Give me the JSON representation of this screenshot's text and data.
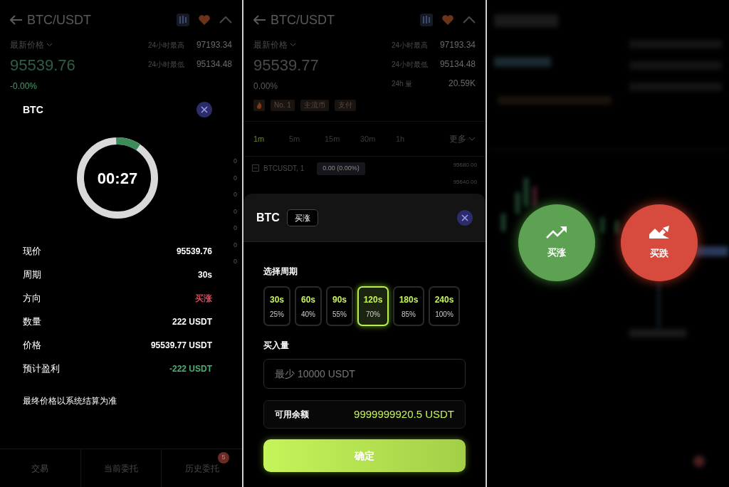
{
  "timer_screen": {
    "header": {
      "title": "BTC/USDT",
      "price_label": "最新价格",
      "price": "95539.76",
      "change": "-0.00%",
      "stats": [
        {
          "label": "24小时最高",
          "value": "97193.34"
        },
        {
          "label": "24小时最低",
          "value": "95134.48"
        }
      ]
    },
    "axis_labels": [
      "0",
      "0",
      "0",
      "0",
      "0",
      "0",
      "0"
    ],
    "dialog": {
      "title": "BTC",
      "timer": "00:27",
      "level": 0.1,
      "rows": [
        {
          "label": "现价",
          "value": "95539.76"
        },
        {
          "label": "周期",
          "value": "30s"
        },
        {
          "label": "方向",
          "value": "买涨",
          "color": "#d9475a"
        },
        {
          "label": "数量",
          "value": "222 USDT"
        },
        {
          "label": "价格",
          "value": "95539.77 USDT"
        },
        {
          "label": "预计盈利",
          "value": "-222 USDT",
          "color": "#4caf72"
        }
      ],
      "note": "最终价格以系统结算为准"
    },
    "nav": [
      {
        "label": "交易"
      },
      {
        "label": "当前委托"
      },
      {
        "label": "历史委托",
        "badge": "5"
      }
    ]
  },
  "order_screen": {
    "header": {
      "title": "BTC/USDT",
      "price_label": "最新价格",
      "price": "95539.77",
      "change": "0.00%",
      "stats": [
        {
          "label": "24小时最高",
          "value": "97193.34"
        },
        {
          "label": "24小时最低",
          "value": "95134.48"
        },
        {
          "label": "24h 量",
          "value": "20.59K"
        }
      ]
    },
    "tags": [
      "No. 1",
      "主流币",
      "支付"
    ],
    "intervals": [
      {
        "label": "1m",
        "selected": true
      },
      {
        "label": "5m",
        "selected": false
      },
      {
        "label": "15m",
        "selected": false
      },
      {
        "label": "30m",
        "selected": false
      },
      {
        "label": "1h",
        "selected": false
      }
    ],
    "more": "更多",
    "chart": {
      "symbol": "BTCUSDT, 1",
      "change": "0.00 (0.00%)",
      "axis_labels": [
        "95680.00",
        "95640.00"
      ]
    },
    "sheet": {
      "title": "BTC",
      "direction": "买涨",
      "period_label": "选择周期",
      "periods": [
        {
          "time": "30s",
          "rate": "25%",
          "selected": false
        },
        {
          "time": "60s",
          "rate": "40%",
          "selected": false
        },
        {
          "time": "90s",
          "rate": "55%",
          "selected": false
        },
        {
          "time": "120s",
          "rate": "70%",
          "selected": true
        },
        {
          "time": "180s",
          "rate": "85%",
          "selected": false
        },
        {
          "time": "240s",
          "rate": "100%",
          "selected": false
        }
      ],
      "amount_label": "买入量",
      "placeholder": "最少 10000 USDT",
      "balance_label": "可用余额",
      "balance": "9999999920.5 USDT",
      "confirm": "确定"
    }
  },
  "direction_screen": {
    "buttons": [
      {
        "kind": "up",
        "label": "买涨"
      },
      {
        "kind": "down",
        "label": "买跌"
      }
    ]
  }
}
